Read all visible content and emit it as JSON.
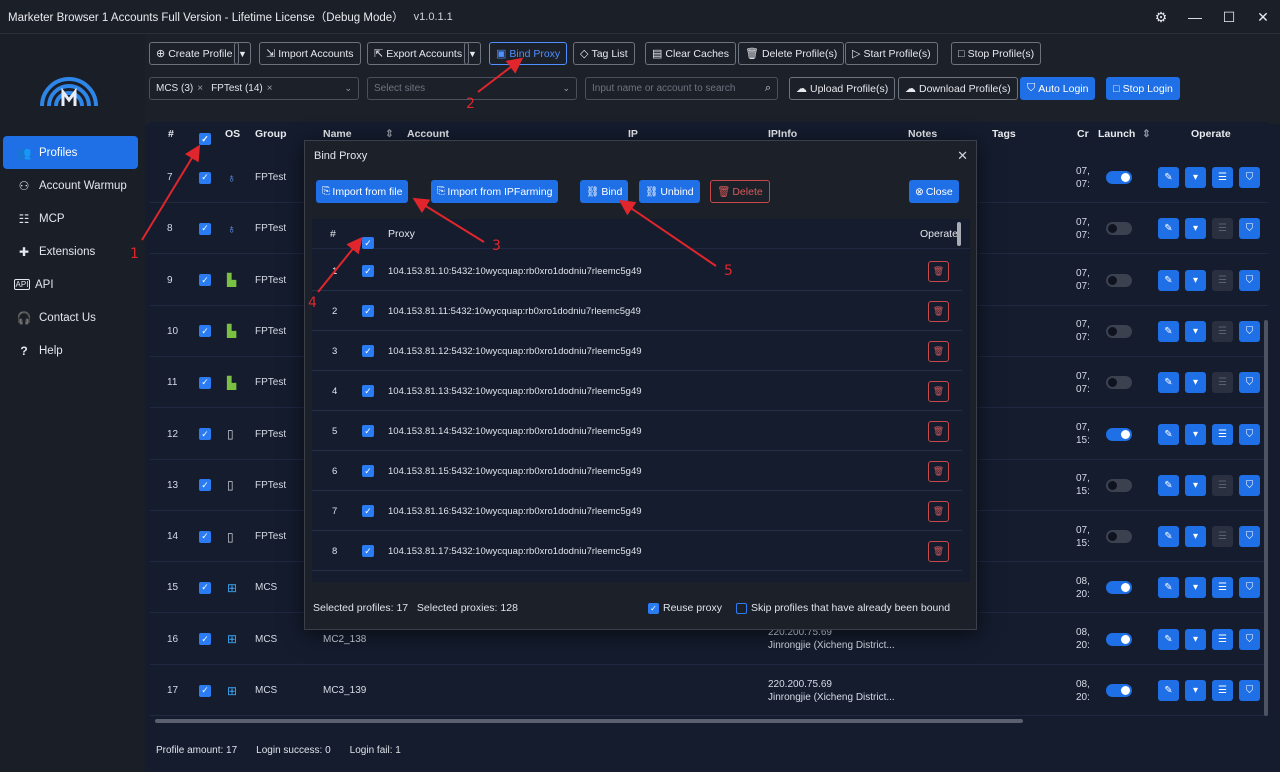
{
  "window": {
    "title": "Marketer Browser 1 Accounts Full Version - Lifetime License（Debug Mode）",
    "version": "v1.0.1.1",
    "icons": [
      "gear-icon",
      "minimize-icon",
      "maximize-icon",
      "close-icon"
    ]
  },
  "sidebar": {
    "items": [
      {
        "label": "Profiles",
        "icon": "users-icon",
        "active": true
      },
      {
        "label": "Account Warmup",
        "icon": "user-gear-icon"
      },
      {
        "label": "MCP",
        "icon": "sliders-icon"
      },
      {
        "label": "Extensions",
        "icon": "puzzle-icon"
      },
      {
        "label": "API",
        "icon": "api-icon"
      },
      {
        "label": "Contact Us",
        "icon": "headset-icon"
      },
      {
        "label": "Help",
        "icon": "question-icon"
      }
    ]
  },
  "toolbar": {
    "create_profile": "Create Profile",
    "import_accounts": "Import Accounts",
    "export_accounts": "Export Accounts",
    "bind_proxy": "Bind Proxy",
    "tag_list": "Tag List",
    "clear_caches": "Clear Caches",
    "delete_profiles": "Delete Profile(s)",
    "start_profiles": "Start Profile(s)",
    "stop_profiles": "Stop Profile(s)",
    "group_tags": [
      "MCS (3)",
      "FPTest (14)"
    ],
    "sites_placeholder": "Select sites",
    "search_placeholder": "Input name or account to search",
    "upload_profiles": "Upload Profile(s)",
    "download_profiles": "Download Profile(s)",
    "auto_login": "Auto Login",
    "stop_login": "Stop Login"
  },
  "table": {
    "headers": {
      "index": "#",
      "os": "OS",
      "group": "Group",
      "name": "Name",
      "account": "Account",
      "ip": "IP",
      "ipinfo": "IPInfo",
      "notes": "Notes",
      "tags": "Tags",
      "created": "Cr",
      "launch": "Launch",
      "operate": "Operate"
    },
    "rows": [
      {
        "index": "7",
        "os": "mac",
        "group": "FPTest",
        "name": "",
        "ipinfo": [
          "",
          ""
        ],
        "date": [
          "07,",
          "07:"
        ],
        "launch": true
      },
      {
        "index": "8",
        "os": "mac",
        "group": "FPTest",
        "name": "",
        "ipinfo": [
          "",
          ""
        ],
        "date": [
          "07,",
          "07:"
        ],
        "launch": false
      },
      {
        "index": "9",
        "os": "android",
        "group": "FPTest",
        "name": "",
        "ipinfo": [
          "",
          ""
        ],
        "date": [
          "07,",
          "07:"
        ],
        "launch": false
      },
      {
        "index": "10",
        "os": "android",
        "group": "FPTest",
        "name": "",
        "ipinfo": [
          "",
          ""
        ],
        "date": [
          "07,",
          "07:"
        ],
        "launch": false
      },
      {
        "index": "11",
        "os": "android",
        "group": "FPTest",
        "name": "",
        "ipinfo": [
          "",
          ""
        ],
        "date": [
          "07,",
          "07:"
        ],
        "launch": false
      },
      {
        "index": "12",
        "os": "ios",
        "group": "FPTest",
        "name": "",
        "ipinfo": [
          "",
          ""
        ],
        "date": [
          "07,",
          "15:"
        ],
        "launch": true
      },
      {
        "index": "13",
        "os": "ios",
        "group": "FPTest",
        "name": "",
        "ipinfo": [
          "",
          ""
        ],
        "date": [
          "07,",
          "15:"
        ],
        "launch": false
      },
      {
        "index": "14",
        "os": "ios",
        "group": "FPTest",
        "name": "",
        "ipinfo": [
          "",
          ""
        ],
        "date": [
          "07,",
          "15:"
        ],
        "launch": false
      },
      {
        "index": "15",
        "os": "windows",
        "group": "MCS",
        "name": "",
        "ipinfo": [
          "",
          ""
        ],
        "date": [
          "08,",
          "20:"
        ],
        "launch": true
      },
      {
        "index": "16",
        "os": "windows",
        "group": "MCS",
        "name": "MC2_138",
        "ipinfo": [
          "220.200.75.69",
          "Jinrongjie (Xicheng District..."
        ],
        "date": [
          "08,",
          "20:"
        ],
        "launch": true
      },
      {
        "index": "17",
        "os": "windows",
        "group": "MCS",
        "name": "MC3_139",
        "ipinfo": [
          "220.200.75.69",
          "Jinrongjie (Xicheng District..."
        ],
        "date": [
          "08,",
          "20:"
        ],
        "launch": true
      }
    ]
  },
  "status": {
    "profile_amount": "Profile amount: 17",
    "login_success": "Login success: 0",
    "login_fail": "Login fail: 1"
  },
  "modal": {
    "title": "Bind Proxy",
    "import_from_file": "Import from file",
    "import_from_ipfarming": "Import from IPFarming",
    "bind": "Bind",
    "unbind": "Unbind",
    "delete": "Delete",
    "close": "Close",
    "headers": {
      "index": "#",
      "proxy": "Proxy",
      "operate": "Operate"
    },
    "proxies": [
      {
        "index": "1",
        "proxy": "104.153.81.10:5432:10wycquap:rb0xro1dodniu7rleemc5g49"
      },
      {
        "index": "2",
        "proxy": "104.153.81.11:5432:10wycquap:rb0xro1dodniu7rleemc5g49"
      },
      {
        "index": "3",
        "proxy": "104.153.81.12:5432:10wycquap:rb0xro1dodniu7rleemc5g49"
      },
      {
        "index": "4",
        "proxy": "104.153.81.13:5432:10wycquap:rb0xro1dodniu7rleemc5g49"
      },
      {
        "index": "5",
        "proxy": "104.153.81.14:5432:10wycquap:rb0xro1dodniu7rleemc5g49"
      },
      {
        "index": "6",
        "proxy": "104.153.81.15:5432:10wycquap:rb0xro1dodniu7rleemc5g49"
      },
      {
        "index": "7",
        "proxy": "104.153.81.16:5432:10wycquap:rb0xro1dodniu7rleemc5g49"
      },
      {
        "index": "8",
        "proxy": "104.153.81.17:5432:10wycquap:rb0xro1dodniu7rleemc5g49"
      }
    ],
    "footer": {
      "selected_profiles": "Selected profiles: 17",
      "selected_proxies": "Selected proxies: 128",
      "reuse_proxy": "Reuse proxy",
      "skip_bound": "Skip profiles that have already been bound"
    }
  },
  "annotations": [
    "1",
    "2",
    "3",
    "4",
    "5"
  ],
  "colors": {
    "accent": "#1f6fe6",
    "annotation": "#e0262c",
    "danger": "#c8494a"
  }
}
